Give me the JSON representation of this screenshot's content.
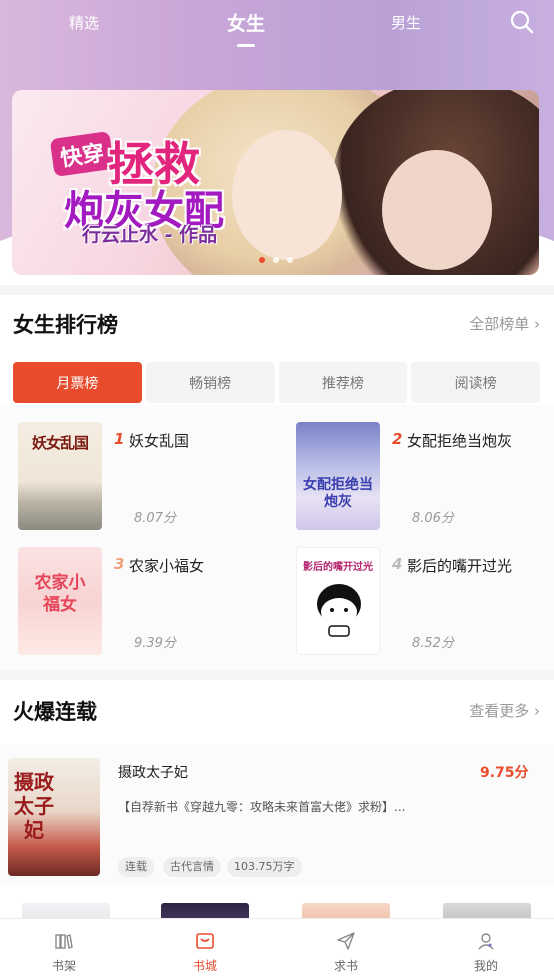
{
  "header": {
    "tabs": [
      "精选",
      "女生",
      "男生"
    ],
    "active_tab": "女生"
  },
  "banner": {
    "tag": "快穿",
    "title_line1": "拯救",
    "title_line2": "炮灰女配",
    "author_line": "行云止水 - 作品"
  },
  "ranking": {
    "title": "女生排行榜",
    "more": "全部榜单 ›",
    "tabs": [
      "月票榜",
      "畅销榜",
      "推荐榜",
      "阅读榜"
    ],
    "books": [
      {
        "rank": "1",
        "name": "妖女乱国",
        "score": "8.07分",
        "cover_text": "妖女乱国"
      },
      {
        "rank": "2",
        "name": "女配拒绝当炮灰",
        "score": "8.06分",
        "cover_text": "女配拒绝当炮灰"
      },
      {
        "rank": "3",
        "name": "农家小福女",
        "score": "9.39分",
        "cover_text": "农家小福女"
      },
      {
        "rank": "4",
        "name": "影后的嘴开过光",
        "score": "8.52分",
        "cover_text": "影后的嘴开过光"
      }
    ]
  },
  "hot": {
    "title": "火爆连载",
    "more": "查看更多 ›",
    "book": {
      "name": "摄政太子妃",
      "score": "9.75分",
      "desc": "【自荐新书《穿越九零：攻略未来首富大佬》求粉】...",
      "cover_text": "摄政太子妃",
      "tags": [
        "连载",
        "古代言情",
        "103.75万字"
      ]
    }
  },
  "bottom_nav": {
    "items": [
      "书架",
      "书城",
      "求书",
      "我的"
    ],
    "active": "书城"
  },
  "colors": {
    "accent": "#e84c2d",
    "header_gradient": "#c9a6d8"
  }
}
